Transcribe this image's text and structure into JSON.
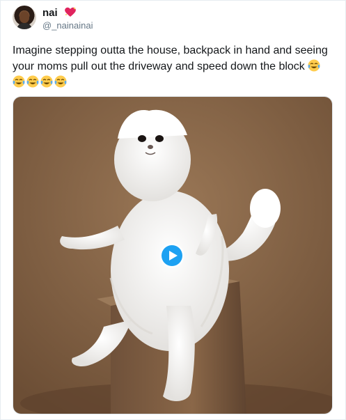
{
  "tweet": {
    "display_name": "nai",
    "name_emoji": "sparkling-heart-icon",
    "handle": "@_nainainai",
    "text": "Imagine stepping outta the house, backpack in hand and seeing your moms pull out the driveway and speed down the block",
    "trailing_emojis": [
      "face-with-tears-of-joy-icon",
      "face-with-tears-of-joy-icon",
      "face-with-tears-of-joy-icon",
      "face-with-tears-of-joy-icon",
      "face-with-tears-of-joy-icon"
    ]
  },
  "media": {
    "type": "video",
    "play_icon": "play-icon"
  },
  "colors": {
    "handle": "#657786",
    "text": "#14171a",
    "play_button": "#1da1f2",
    "background_wall": "#8b6a4c"
  }
}
